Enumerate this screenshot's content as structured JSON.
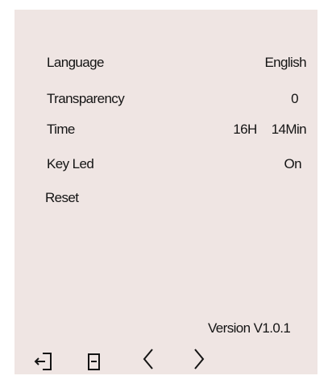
{
  "settings": {
    "items": [
      {
        "label": "Language",
        "value": "English"
      },
      {
        "label": "Transparency",
        "value": "0"
      },
      {
        "label": "Time",
        "hours": "16H",
        "minutes": "14Min"
      },
      {
        "label": "Key Led",
        "value": "On"
      },
      {
        "label": "Reset"
      }
    ],
    "version_label": "Version",
    "version_value": "V1.0.1"
  },
  "navbar": {
    "icons": [
      "exit-icon",
      "menu-icon",
      "chevron-left-icon",
      "chevron-right-icon"
    ]
  },
  "colors": {
    "panel_bg": "#efe5e3",
    "text": "#141414"
  }
}
